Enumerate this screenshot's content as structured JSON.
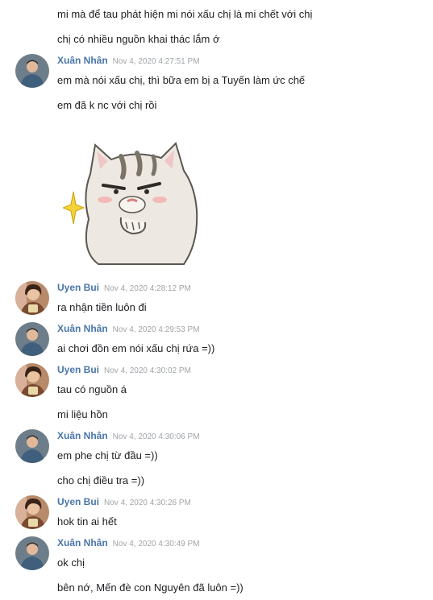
{
  "messages": [
    {
      "text": "mi mà để tau phát hiện mi nói xấu chị là mi chết với chị"
    },
    {
      "text": "chị có nhiều nguồn khai thác lắm ớ"
    },
    {
      "sender": "Xuân Nhân",
      "time": "Nov 4, 2020 4:27:51 PM",
      "text": "em mà nói xấu chị, thì bữa em bị a Tuyến làm ức chế"
    },
    {
      "text": "em đã k nc với chị rồi"
    },
    {
      "sender": "Uyen Bui",
      "time": "Nov 4, 2020 4:28:12 PM",
      "text": "ra nhận tiền luôn đi"
    },
    {
      "sender": "Xuân Nhân",
      "time": "Nov 4, 2020 4:29:53 PM",
      "text": "ai chơi đồn em nói xấu chị rứa =))"
    },
    {
      "sender": "Uyen Bui",
      "time": "Nov 4, 2020 4:30:02 PM",
      "text": "tau có nguồn á"
    },
    {
      "text": "mi liệu hồn"
    },
    {
      "sender": "Xuân Nhân",
      "time": "Nov 4, 2020 4:30:06 PM",
      "text": "em phe chị từ đầu =))"
    },
    {
      "text": "cho chị điều tra =))"
    },
    {
      "sender": "Uyen Bui",
      "time": "Nov 4, 2020 4:30:26 PM",
      "text": "hok tin ai hết"
    },
    {
      "sender": "Xuân Nhân",
      "time": "Nov 4, 2020 4:30:49 PM",
      "text": "ok chị"
    },
    {
      "text": "bên nớ, Mến đè con Nguyên đã luôn =))"
    }
  ],
  "colors": {
    "sender_name": "#4a76a8",
    "timestamp": "#a0a4a8",
    "text": "#1c1e21"
  }
}
